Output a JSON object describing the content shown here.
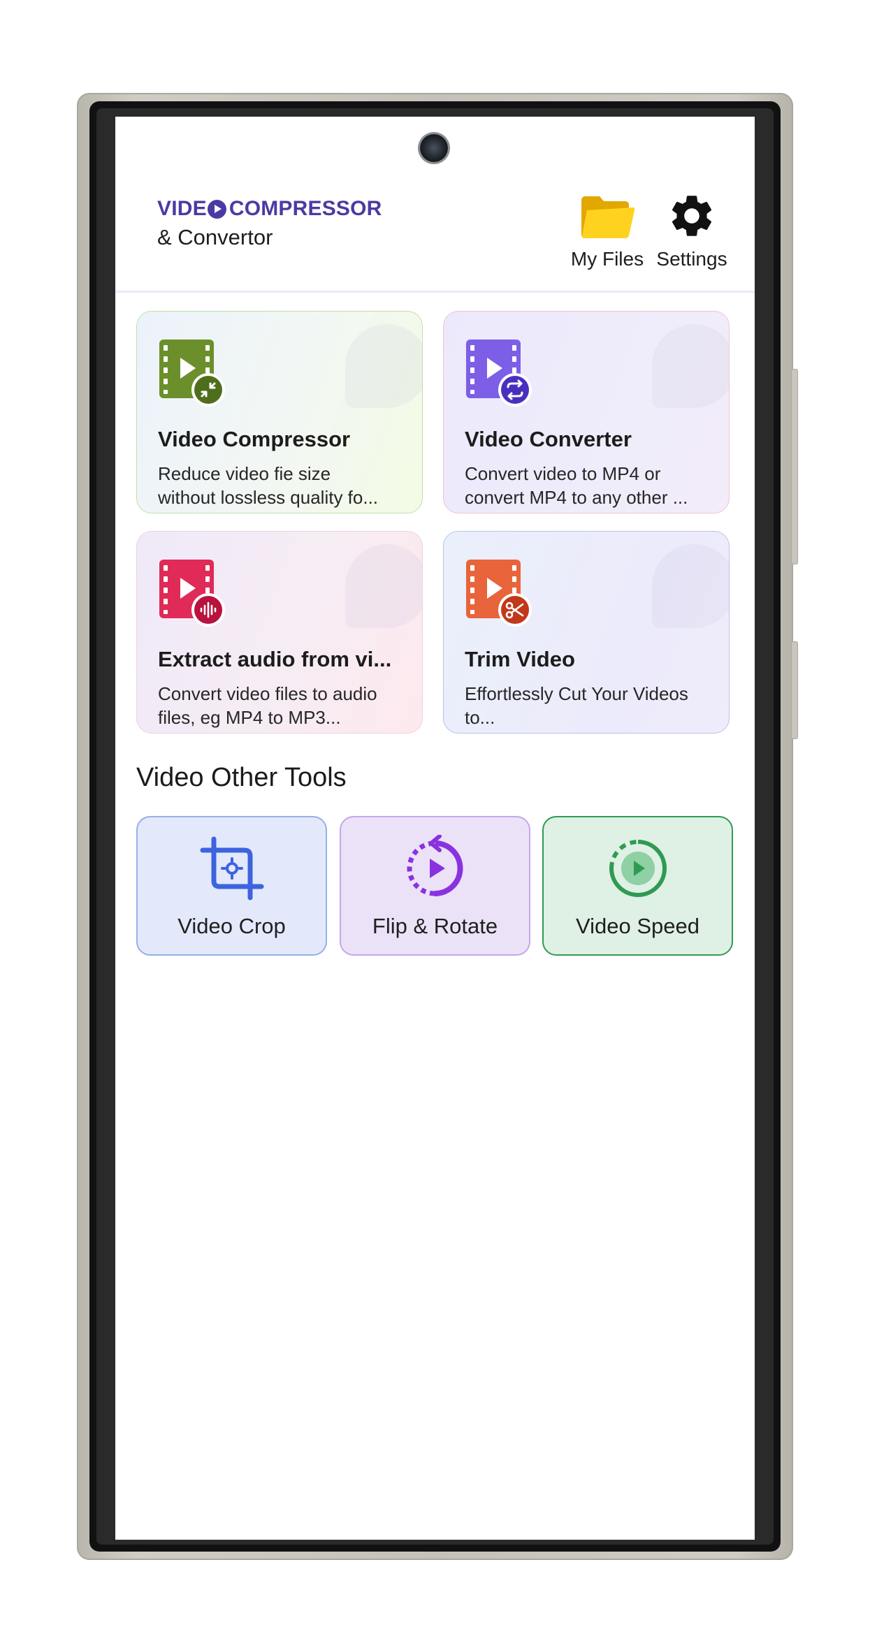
{
  "header": {
    "logo_line1_a": "VIDE",
    "logo_line1_b": "COMPRESSOR",
    "logo_line2": "& Convertor",
    "my_files_label": "My Files",
    "settings_label": "Settings"
  },
  "cards": [
    {
      "title": "Video Compressor",
      "desc_line1": "Reduce video fie size",
      "desc_line2": "without lossless quality fo...",
      "icon": "video-compress-icon",
      "color": "#6b8f2a"
    },
    {
      "title": "Video Converter",
      "desc_line1": "Convert video to MP4 or",
      "desc_line2": "convert MP4 to any other ...",
      "icon": "video-convert-icon",
      "color": "#6a4fd8"
    },
    {
      "title": "Extract audio from vi...",
      "desc_line1": "Convert video files to audio",
      "desc_line2": "files, eg MP4 to MP3...",
      "icon": "video-audio-icon",
      "color": "#d92553"
    },
    {
      "title": "Trim Video",
      "desc_line1": "Effortlessly Cut Your Videos",
      "desc_line2": "to...",
      "icon": "video-trim-icon",
      "color": "#e45a2f"
    }
  ],
  "section": {
    "title": "Video Other Tools"
  },
  "tools": [
    {
      "label": "Video Crop",
      "icon": "crop-icon",
      "color": "#3d63df"
    },
    {
      "label": "Flip & Rotate",
      "icon": "rotate-play-icon",
      "color": "#8a32e0"
    },
    {
      "label": "Video Speed",
      "icon": "speed-play-icon",
      "color": "#2f9b52"
    }
  ]
}
